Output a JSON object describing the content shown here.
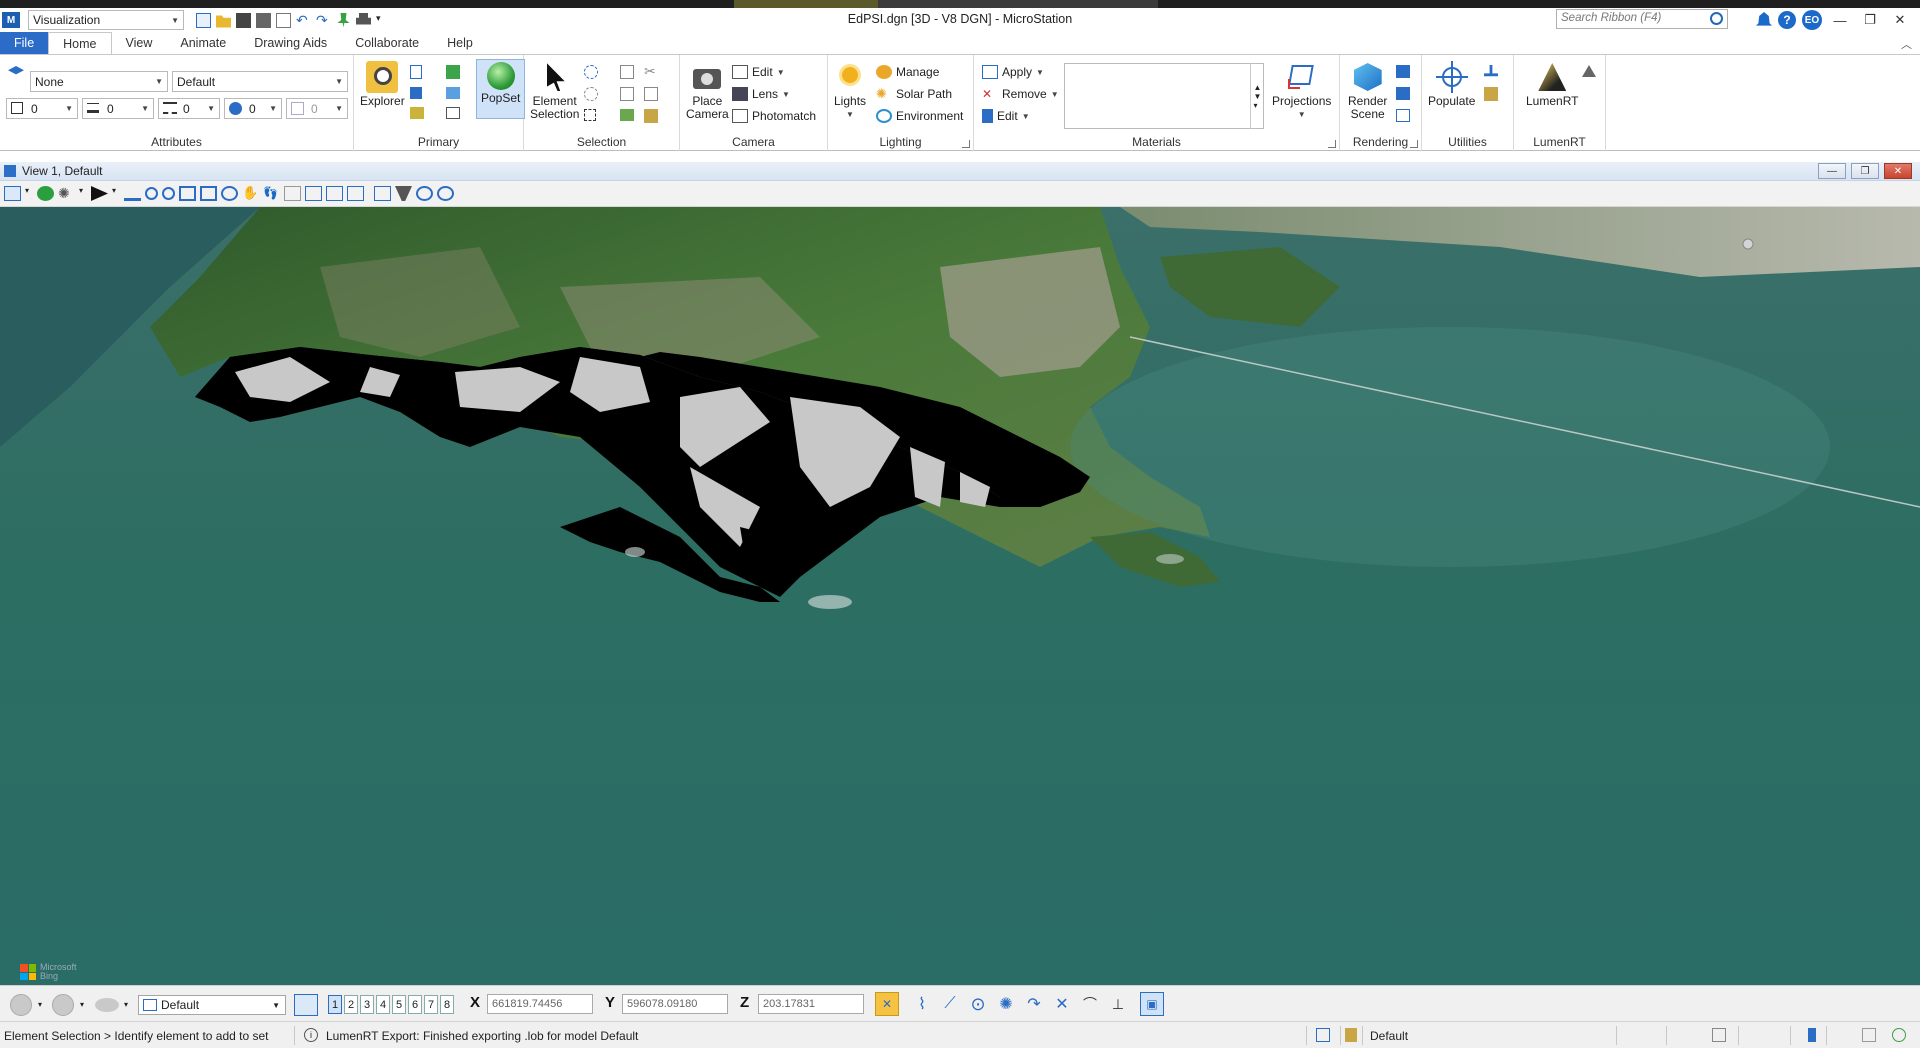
{
  "app": {
    "window_title": "EdPSI.dgn [3D - V8 DGN] - MicroStation",
    "workflow": "Visualization",
    "search_placeholder": "Search Ribbon (F4)",
    "user_initials": "EO",
    "help_label": "?"
  },
  "tabs": [
    {
      "label": "File"
    },
    {
      "label": "Home"
    },
    {
      "label": "View"
    },
    {
      "label": "Animate"
    },
    {
      "label": "Drawing Aids"
    },
    {
      "label": "Collaborate"
    },
    {
      "label": "Help"
    }
  ],
  "ribbon": {
    "attributes": {
      "label": "Attributes",
      "level": "None",
      "style": "Default",
      "color": "0",
      "weight": "0",
      "linestyle": "0",
      "transparency": "0",
      "priority": "0"
    },
    "primary": {
      "label": "Primary",
      "explorer": "Explorer",
      "popset": "PopSet"
    },
    "selection": {
      "label": "Selection",
      "element_selection_line1": "Element",
      "element_selection_line2": "Selection"
    },
    "camera": {
      "label": "Camera",
      "place_camera_line1": "Place",
      "place_camera_line2": "Camera",
      "edit": "Edit",
      "lens": "Lens",
      "photomatch": "Photomatch"
    },
    "lighting": {
      "label": "Lighting",
      "lights": "Lights",
      "manage": "Manage",
      "solar_path": "Solar Path",
      "environment": "Environment"
    },
    "materials": {
      "label": "Materials",
      "apply": "Apply",
      "remove": "Remove",
      "edit": "Edit",
      "projections": "Projections"
    },
    "rendering": {
      "label": "Rendering",
      "render_scene_line1": "Render",
      "render_scene_line2": "Scene"
    },
    "utilities": {
      "label": "Utilities",
      "populate": "Populate"
    },
    "lumenrt": {
      "label": "LumenRT",
      "lumenrt": "LumenRT"
    }
  },
  "view": {
    "title": "View 1, Default",
    "attribution_line1": "Microsoft",
    "attribution_line2": "Bing"
  },
  "bottom": {
    "active_model": "Default",
    "view_numbers": [
      "1",
      "2",
      "3",
      "4",
      "5",
      "6",
      "7",
      "8"
    ],
    "active_view": "1",
    "x_label": "X",
    "x_value": "661819.74456",
    "y_label": "Y",
    "y_value": "596078.09180",
    "z_label": "Z",
    "z_value": "203.17831"
  },
  "status": {
    "prompt": "Element Selection > Identify element to add to set",
    "message": "LumenRT Export: Finished exporting .lob for model Default",
    "active_model": "Default"
  },
  "colors": {
    "accent": "#2a6cc8",
    "sea": "#2c6e66",
    "land": "#3c6a33",
    "mesh_fill": "#c8c8c8"
  }
}
